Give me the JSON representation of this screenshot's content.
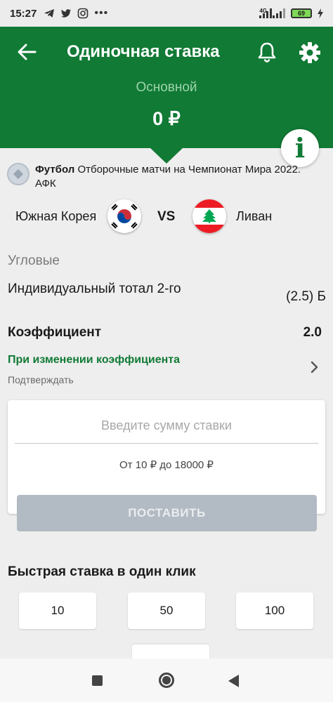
{
  "status_bar": {
    "time": "15:27",
    "left_icons": [
      "telegram-icon",
      "twitter-icon",
      "instagram-icon",
      "more-dots-icon"
    ],
    "network": "4G",
    "battery": "69"
  },
  "header": {
    "title": "Одиночная ставка",
    "subtitle": "Основной",
    "amount": "0 ₽",
    "color": "#117a35"
  },
  "event": {
    "sport": "Футбол",
    "tournament": "Отборочные матчи на Чемпионат Мира 2022. АФК"
  },
  "match": {
    "team1": "Южная Корея",
    "vs": "VS",
    "team2": "Ливан"
  },
  "bet": {
    "market": "Угловые",
    "name": "Индивидуальный тотал 2-го",
    "value": "(2.5) Б",
    "coef_label": "Коэффициент",
    "coef_value": "2.0",
    "change_label": "При изменении коэффициента",
    "change_value": "Подтверждать"
  },
  "stake": {
    "placeholder": "Введите сумму ставки",
    "range": "От 10 ₽ до 18000 ₽",
    "button": "ПОСТАВИТЬ"
  },
  "quick_bet": {
    "title": "Быстрая ставка в один клик",
    "amounts": [
      "10",
      "50",
      "100"
    ]
  }
}
